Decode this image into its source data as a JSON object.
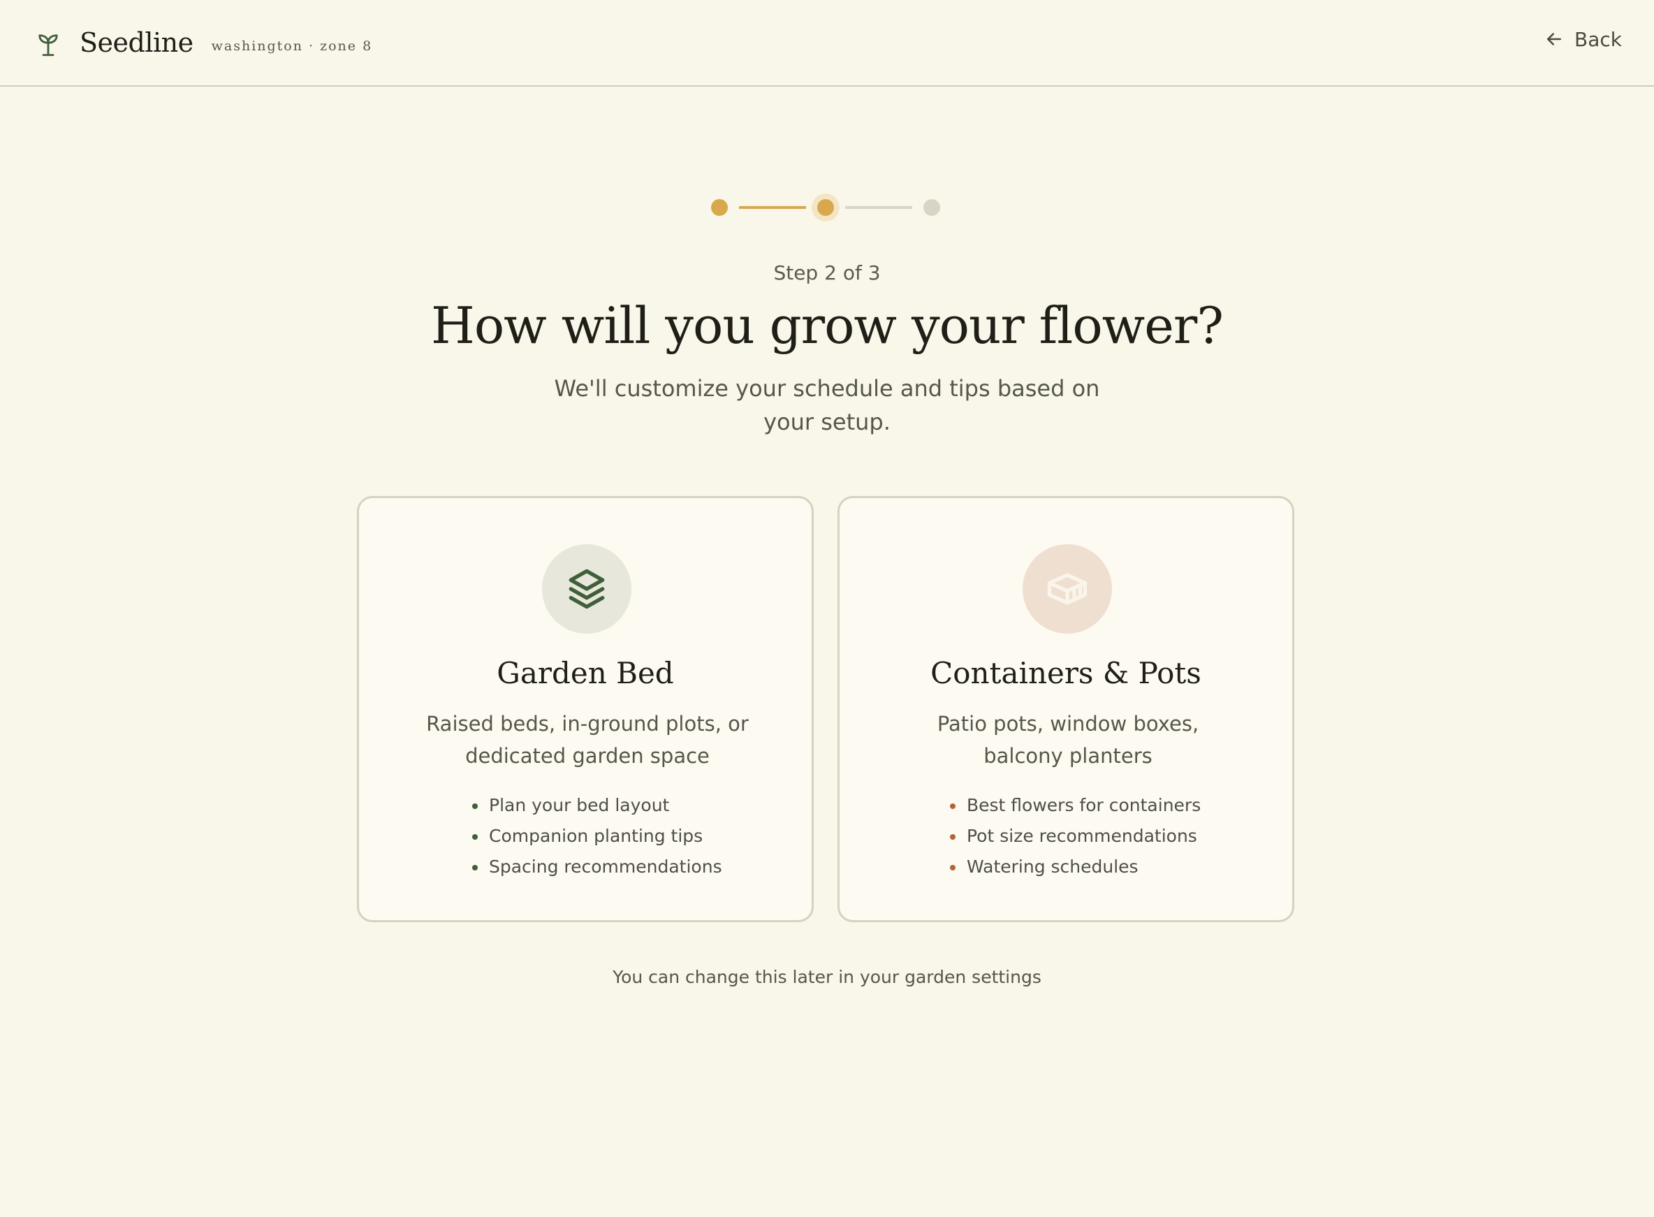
{
  "header": {
    "brand_name": "Seedline",
    "brand_sub": "washington · zone 8",
    "back_label": "Back"
  },
  "stepper": {
    "current_step": 2,
    "total_steps": 3,
    "step_label": "Step 2 of 3"
  },
  "main": {
    "title": "How will you grow your flower?",
    "subtitle": "We'll customize your schedule and tips based on your setup."
  },
  "options": [
    {
      "title": "Garden Bed",
      "description": "Raised beds, in-ground plots, or dedicated garden space",
      "features": [
        "Plan your bed layout",
        "Companion planting tips",
        "Spacing recommendations"
      ],
      "icon": "layers-icon"
    },
    {
      "title": "Containers & Pots",
      "description": "Patio pots, window boxes, balcony planters",
      "features": [
        "Best flowers for containers",
        "Pot size recommendations",
        "Watering schedules"
      ],
      "icon": "container-icon"
    }
  ],
  "footer_note": "You can change this later in your garden settings",
  "colors": {
    "background": "#f9f6ea",
    "accent": "#d9a84e",
    "green": "#3f5f3a",
    "terracotta": "#b5623a"
  }
}
